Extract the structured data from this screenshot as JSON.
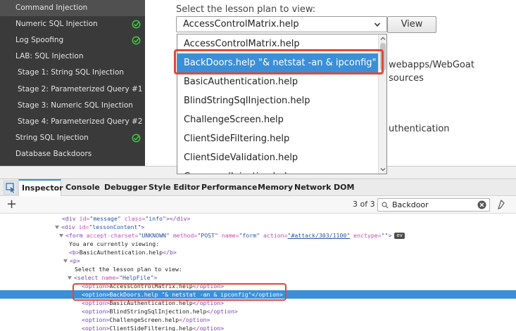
{
  "sidebar": {
    "items": [
      {
        "label": "Command Injection",
        "completed": false
      },
      {
        "label": "Numeric SQL Injection",
        "completed": true
      },
      {
        "label": "Log Spoofing",
        "completed": true
      },
      {
        "label": "LAB: SQL Injection",
        "completed": false
      },
      {
        "label": "Stage 1: String SQL Injection",
        "completed": false
      },
      {
        "label": "Stage 2: Parameterized Query #1",
        "completed": false
      },
      {
        "label": "Stage 3: Numeric SQL Injection",
        "completed": false
      },
      {
        "label": "Stage 4: Parameterized Query #2",
        "completed": false
      },
      {
        "label": "String SQL Injection",
        "completed": true
      },
      {
        "label": "Database Backdoors",
        "completed": false
      }
    ],
    "check_color": "#3fbf3f"
  },
  "lesson": {
    "select_label": "Select the lesson plan to view:",
    "selected_value": "AccessControlMatrix.help",
    "view_button": "View",
    "background_fragments": [
      "webapps/WebGoat",
      "sources",
      "uthentication"
    ],
    "options": [
      "AccessControlMatrix.help",
      "BackDoors.help \"& netstat -an & ipconfig\"",
      "BasicAuthentication.help",
      "BlindStringSqlInjection.help",
      "ChallengeScreen.help",
      "ClientSideFiltering.help",
      "ClientSideValidation.help",
      "CommandInjection.help"
    ],
    "highlighted_option_index": 1,
    "highlight_color": "#3b8fd8",
    "annotation_color": "#e04836"
  },
  "devtools": {
    "tabs": [
      "Inspector",
      "Console",
      "Debugger",
      "Style Editor",
      "Performance",
      "Memory",
      "Network",
      "DOM"
    ],
    "active_tab": "Inspector",
    "match_count": "3 of 3",
    "search_value": "Backdoor",
    "markup": {
      "l1": {
        "t1": "<div",
        "a1": " id=",
        "v1": "\"message\"",
        "a2": " class=",
        "v2": "\"info\"",
        "t2": "></div>"
      },
      "l2": {
        "t1": "<div",
        "a1": " id=",
        "v1": "\"lessonContent\"",
        "t2": ">"
      },
      "l3": {
        "t1": "<form",
        "a1": " accept-charset=",
        "v1": "\"UNKNOWN\"",
        "a2": " method=",
        "v2": "\"POST\"",
        "a3": " name=",
        "v3": "\"form\"",
        "a4": " action=",
        "v4": "\"#attack/303/1100\"",
        "a5": " enctype=",
        "v5": "\"\"",
        "t2": ">",
        "badge": "ev"
      },
      "l4": {
        "text": "You are currently viewing:"
      },
      "l5": {
        "t1": "<b>",
        "text": "BasicAuthentication.help",
        "t2": "</b>"
      },
      "l6": {
        "t1": "<p>"
      },
      "l7": {
        "text": "Select the lesson plan to view:"
      },
      "l8": {
        "t1": "<select",
        "a1": " name=",
        "v1": "\"HelpFile\"",
        "t2": ">"
      },
      "l9": {
        "t1": "<option>",
        "text": "AccessControlMatrix.help",
        "t2": "</option>"
      },
      "l10": {
        "t1": "<option>",
        "text": "BackDoors.help \"& netstat -an & ipconfig\"",
        "t2": "</option>"
      },
      "l11": {
        "t1": "<option>",
        "text": "BasicAuthentication.help",
        "t2": "</option>"
      },
      "l12": {
        "t1": "<option>",
        "text": "BlindStringSqlInjection.help",
        "t2": "</option>"
      },
      "l13": {
        "t1": "<option>",
        "text": "ChallengeScreen.help",
        "t2": "</option>"
      },
      "l14": {
        "t1": "<option>",
        "text": "ClientSideFiltering.help",
        "t2": "</option>"
      }
    }
  }
}
